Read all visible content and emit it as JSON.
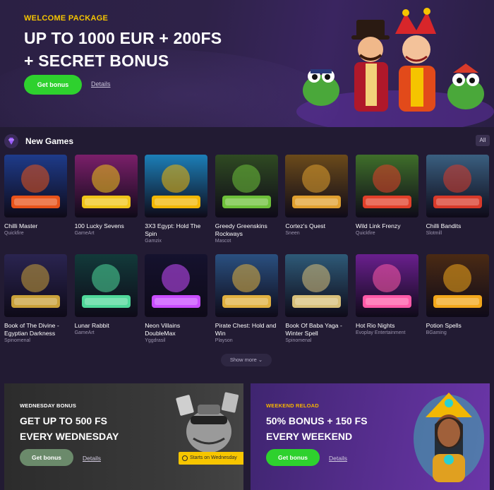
{
  "hero": {
    "eyebrow": "WELCOME PACKAGE",
    "title_line1": "UP TO 1000 EUR + 200FS",
    "title_line2": "+ SECRET BONUS",
    "button": "Get bonus",
    "details": "Details"
  },
  "new_games": {
    "title": "New Games",
    "all_label": "All",
    "show_more": "Show more",
    "games": [
      {
        "name": "Chilli Master",
        "provider": "Quickfire",
        "thumb_color": "#1e3b8a",
        "accent": "#e8531a"
      },
      {
        "name": "100 Lucky Sevens",
        "provider": "GameArt",
        "thumb_color": "#7b1f6a",
        "accent": "#f0c419"
      },
      {
        "name": "3X3 Egypt: Hold The Spin",
        "provider": "Gamzix",
        "thumb_color": "#1c7fb8",
        "accent": "#f2b705"
      },
      {
        "name": "Greedy Greenskins Rockways",
        "provider": "Mascot",
        "thumb_color": "#2f4a22",
        "accent": "#6ec13a"
      },
      {
        "name": "Cortez's Quest",
        "provider": "Sneen",
        "thumb_color": "#6b4a1a",
        "accent": "#e0a030"
      },
      {
        "name": "Wild Link Frenzy",
        "provider": "Quickfire",
        "thumb_color": "#3f6f2a",
        "accent": "#e2402a"
      },
      {
        "name": "Chilli Bandits",
        "provider": "Slotmill",
        "thumb_color": "#3a5f80",
        "accent": "#d83a2a"
      },
      {
        "name": "Book of The Divine - Egyptian Darkness",
        "provider": "Spinomenal",
        "thumb_color": "#2a2450",
        "accent": "#c9a13a"
      },
      {
        "name": "Lunar Rabbit",
        "provider": "GameArt",
        "thumb_color": "#123a3a",
        "accent": "#4fd89a"
      },
      {
        "name": "Neon Villains DoubleMax",
        "provider": "Yggdrasil",
        "thumb_color": "#15122e",
        "accent": "#c94dff"
      },
      {
        "name": "Pirate Chest: Hold and Win",
        "provider": "Playson",
        "thumb_color": "#2a5080",
        "accent": "#e0b040"
      },
      {
        "name": "Book Of Baba Yaga - Winter Spell",
        "provider": "Spinomenal",
        "thumb_color": "#2e5a78",
        "accent": "#d8c07a"
      },
      {
        "name": "Hot Rio Nights",
        "provider": "Evoplay Entertainment",
        "thumb_color": "#6a1f8e",
        "accent": "#ff5aa8"
      },
      {
        "name": "Potion Spells",
        "provider": "BGaming",
        "thumb_color": "#4a2a14",
        "accent": "#f2a71b"
      }
    ]
  },
  "promos": {
    "wednesday": {
      "eyebrow": "WEDNESDAY BONUS",
      "title_line1": "GET UP TO 500 FS",
      "title_line2": "EVERY WEDNESDAY",
      "button": "Get bonus",
      "details": "Details",
      "badge": "Starts on Wednesday"
    },
    "weekend": {
      "eyebrow": "WEEKEND RELOAD",
      "title_line1": "50% BONUS + 150 FS",
      "title_line2": "EVERY WEEKEND",
      "button": "Get bonus",
      "details": "Details"
    }
  },
  "colors": {
    "background": "#221b33",
    "accent_yellow": "#f5c400",
    "button_green": "#2ed12e",
    "button_muted_green": "#6b8a6b",
    "weekend_eyebrow": "#f7b500"
  }
}
